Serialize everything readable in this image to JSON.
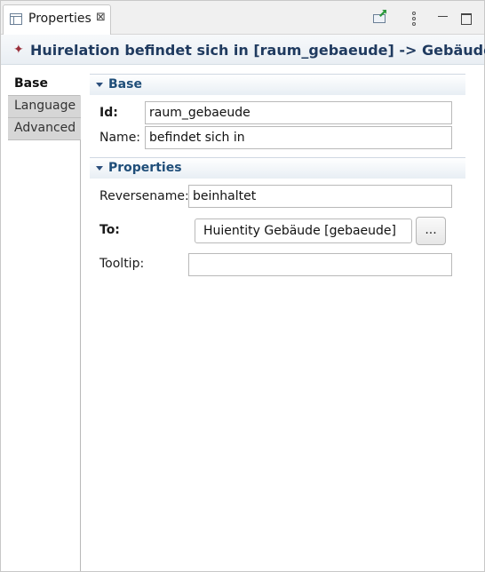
{
  "view": {
    "tab_label": "Properties",
    "tab_close": "⊠",
    "toolbar": {
      "pin_icon": "pin-to-view-icon",
      "menu_icon": "view-menu-icon",
      "minimize_icon": "minimize-icon",
      "maximize_icon": "maximize-icon"
    }
  },
  "title": {
    "icon_glyph": "✦",
    "text": "Huirelation befindet sich in [raum_gebaeude] -> Gebäude"
  },
  "side_tabs": [
    {
      "label": "Base",
      "active": true
    },
    {
      "label": "Language",
      "active": false
    },
    {
      "label": "Advanced",
      "active": false
    }
  ],
  "base_section": {
    "title": "Base",
    "id_label": "Id:",
    "id_value": "raum_gebaeude",
    "name_label": "Name:",
    "name_value": "befindet sich in"
  },
  "properties_section": {
    "title": "Properties",
    "reversename_label": "Reversename:",
    "reversename_value": "beinhaltet",
    "to_label": "To:",
    "to_value": "Huientity Gebäude [gebaeude]",
    "browse_label": "...",
    "tooltip_label": "Tooltip:",
    "tooltip_value": ""
  },
  "colors": {
    "title_text": "#1f3a5f",
    "section_text": "#1f4e79",
    "title_icon": "#9a2f3a"
  }
}
